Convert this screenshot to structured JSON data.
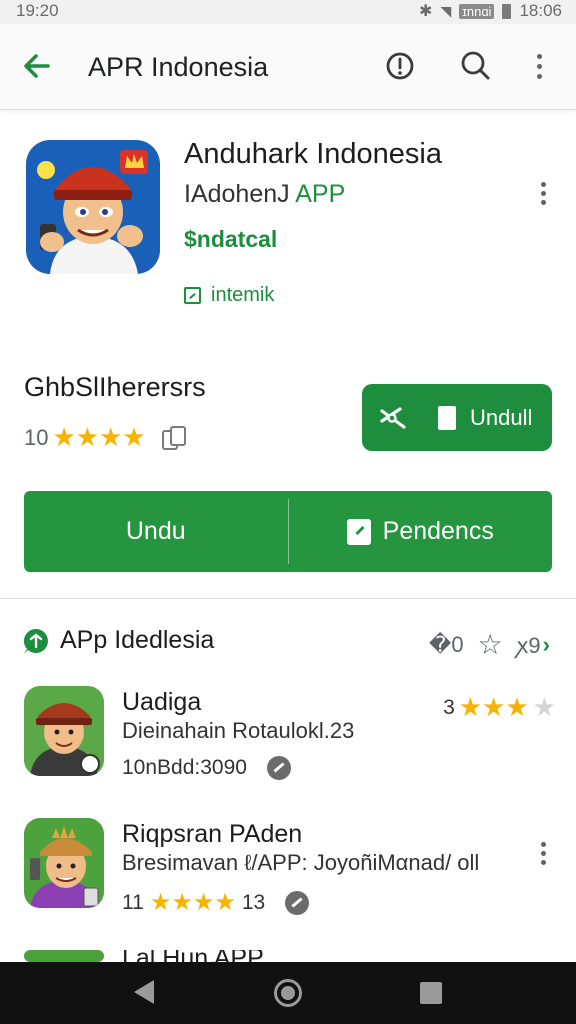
{
  "status_bar": {
    "time": "19:20",
    "bluetooth_icon": "bluetooth-icon",
    "wifi_icon": "wifi-icon",
    "network": "ɪnnɑi",
    "battery_icon": "battery-icon",
    "clock": "18:06"
  },
  "app_bar": {
    "title": "APR Indonesia",
    "back_icon": "arrow-left-icon",
    "actions": [
      "info-icon",
      "search-icon",
      "more-vert-icon"
    ]
  },
  "app": {
    "name": "Anduhark Indonesia",
    "developer_prefix": "IAdohenJ",
    "developer_suffix": "APP",
    "price": "$ndatcal",
    "category": "intemik",
    "rating_title": "GhbSlIherersrs",
    "rating_value": "10",
    "stars": "★★★★",
    "install_label": "Undull",
    "primary_button": "Undu",
    "secondary_button": "Pendencs"
  },
  "section": {
    "title": "APp Idedlesia",
    "actions": [
      "�0",
      "☆",
      "ꭗ9"
    ],
    "chevron": "›"
  },
  "list": [
    {
      "title": "Uadiga",
      "subtitle": "Dieinahain Rotaulokl.23",
      "meta": "10nBdd:3090",
      "rating": "3",
      "stars_filled": "★★★",
      "stars_empty": "★"
    },
    {
      "title": "Riqpsran PAden",
      "subtitle": "Bresimavan ℓ/APP: JoyoñiMαnad/   oll",
      "meta_prefix": "11",
      "stars": "★★★★",
      "meta_suffix": "13"
    },
    {
      "title": "Lal Hun APP"
    }
  ],
  "colors": {
    "accent_green": "#1e8e3e",
    "star": "#f6b300",
    "nav_bg": "#111111"
  }
}
